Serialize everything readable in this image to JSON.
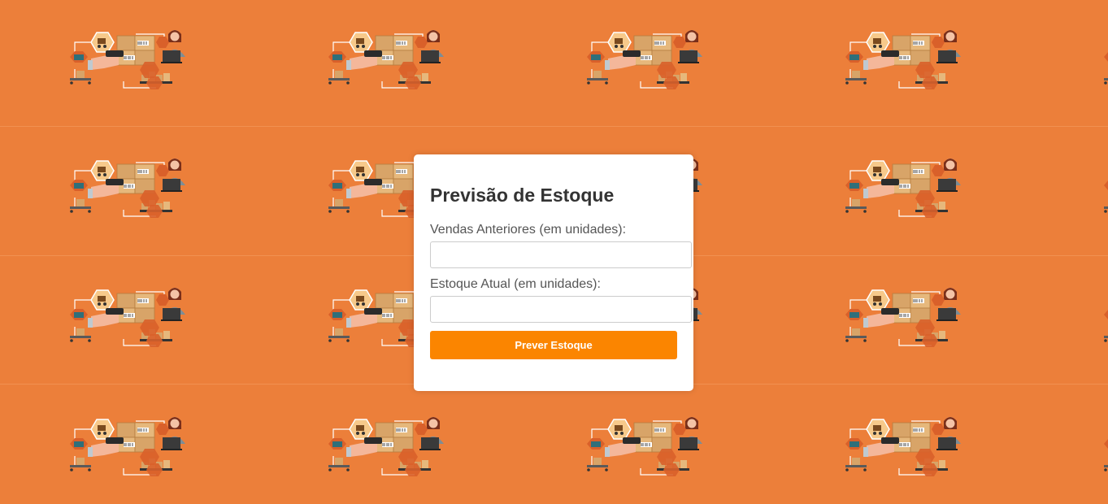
{
  "page": {
    "background_color": "#ec7f3a",
    "background_icon": "warehouse-inventory-illustration"
  },
  "form": {
    "title": "Previsão de Estoque",
    "vendas_label": "Vendas Anteriores (em unidades):",
    "vendas_value": "",
    "estoque_label": "Estoque Atual (em unidades):",
    "estoque_value": "",
    "submit_label": "Prever Estoque",
    "accent_color": "#fb8500"
  }
}
